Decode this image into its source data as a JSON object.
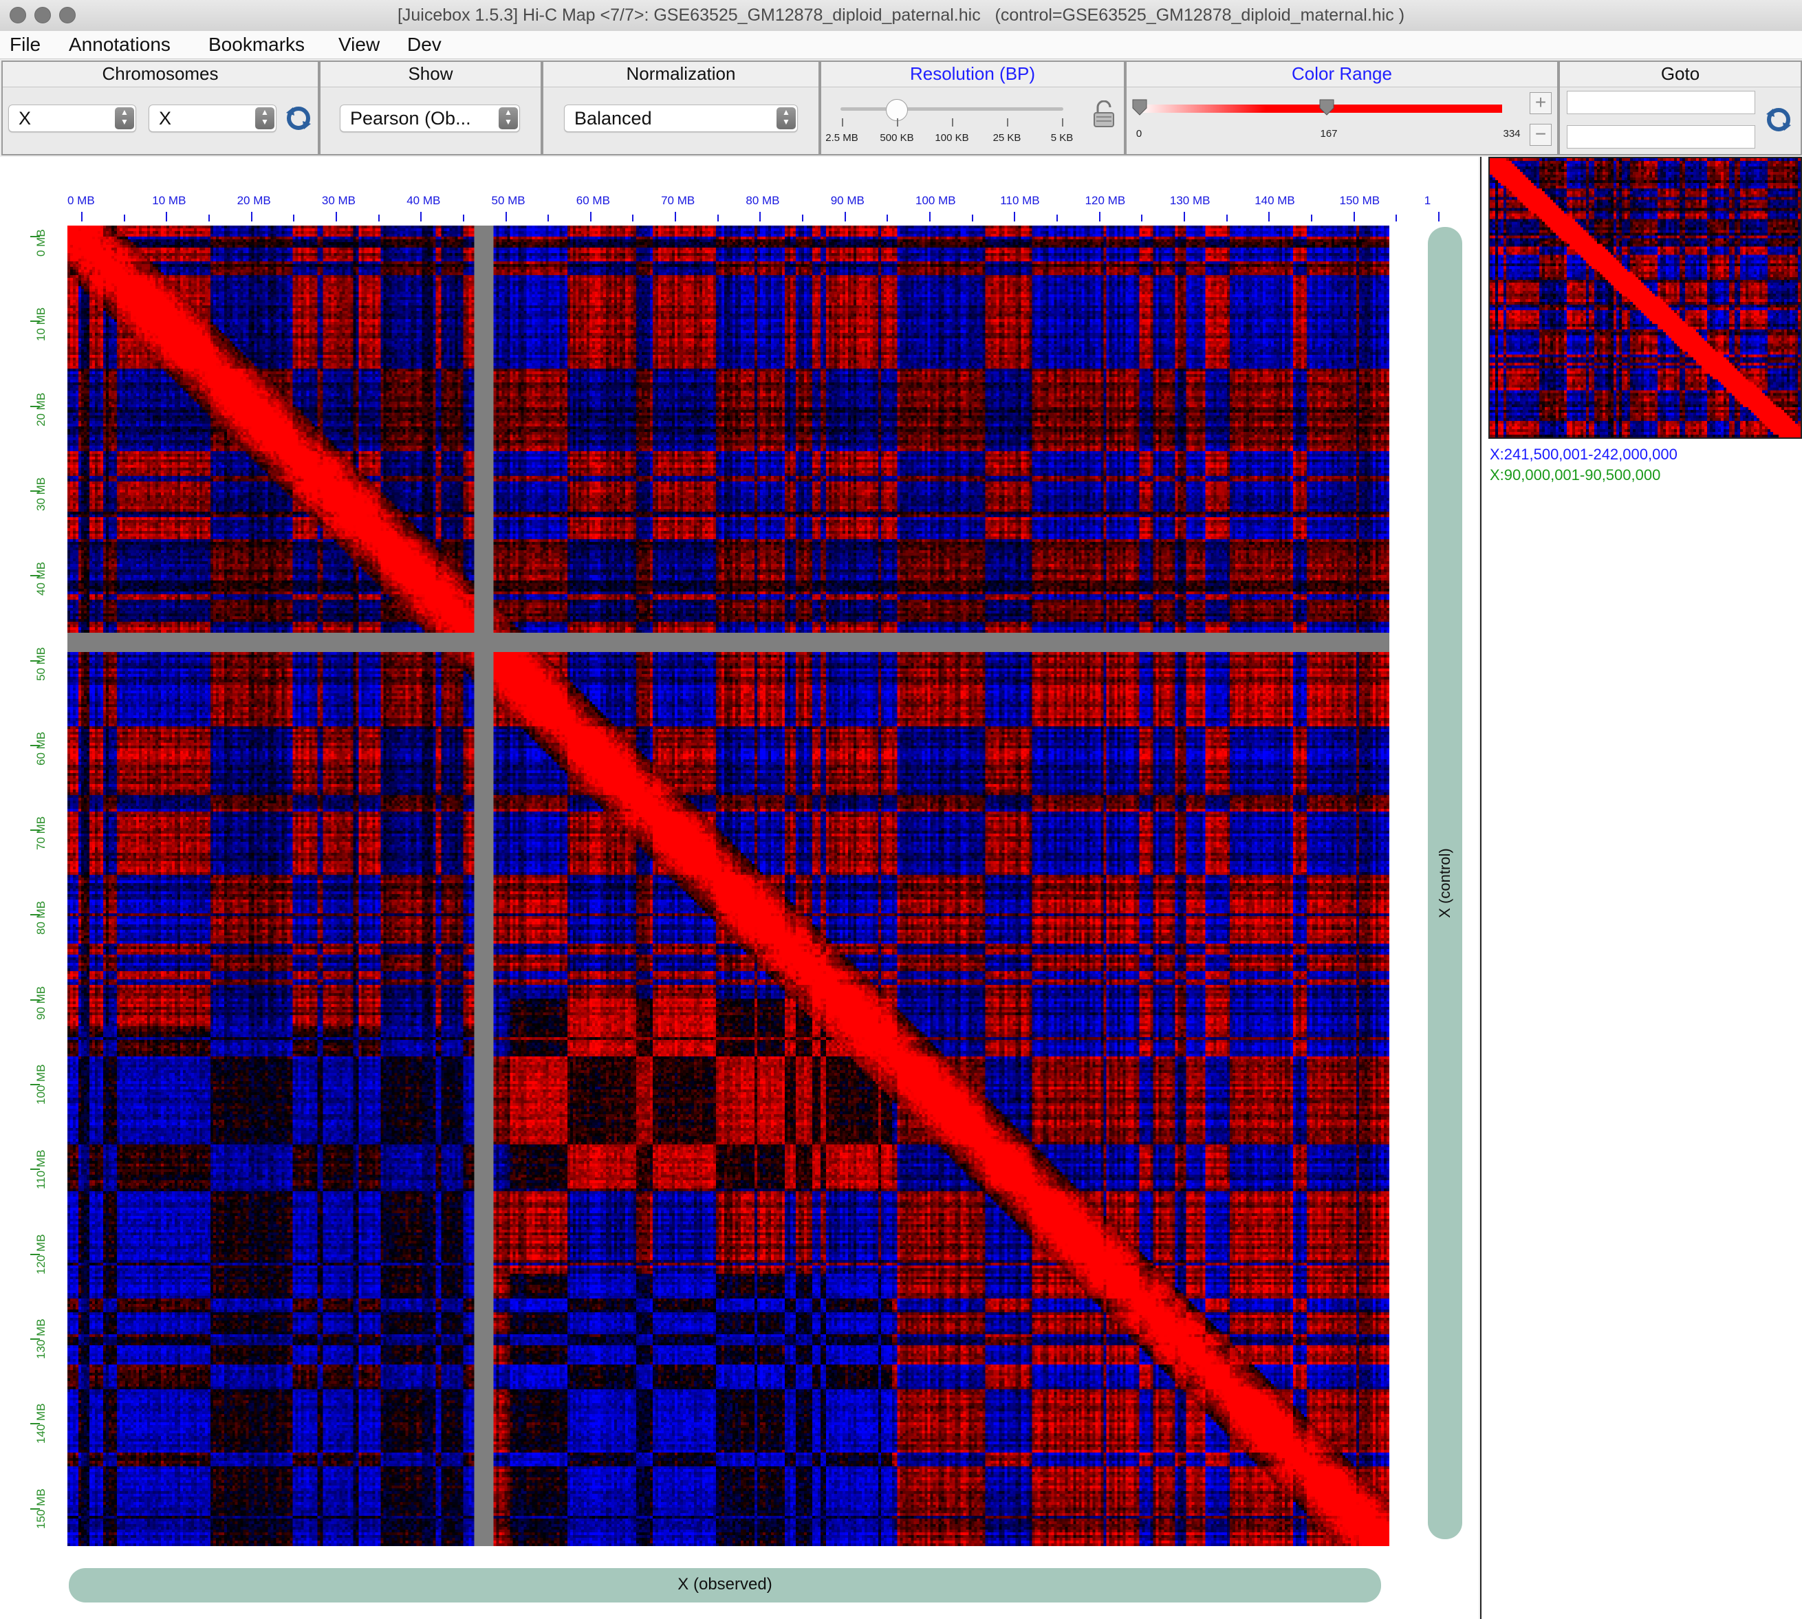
{
  "window": {
    "title": "[Juicebox 1.5.3] Hi-C Map <7/7>: GSE63525_GM12878_diploid_paternal.hic   (control=GSE63525_GM12878_diploid_maternal.hic )"
  },
  "menu": [
    "File",
    "Annotations",
    "Bookmarks",
    "View",
    "Dev"
  ],
  "toolbar": {
    "chromosomes": {
      "label": "Chromosomes",
      "chr1": "X",
      "chr2": "X"
    },
    "show": {
      "label": "Show",
      "value": "Pearson (Ob..."
    },
    "normalization": {
      "label": "Normalization",
      "value": "Balanced"
    },
    "resolution": {
      "label": "Resolution (BP)",
      "ticks": [
        "2.5 MB",
        "500 KB",
        "100 KB",
        "25 KB",
        "5 KB"
      ],
      "selected": "500 KB"
    },
    "color_range": {
      "label": "Color Range",
      "min": "0",
      "mid": "167",
      "max": "334",
      "min_color": "#ffffff",
      "max_color": "#ff0000"
    },
    "goto": {
      "label": "Goto",
      "field1": "",
      "field2": ""
    }
  },
  "map": {
    "x_ticks": [
      "0 MB",
      "10 MB",
      "20 MB",
      "30 MB",
      "40 MB",
      "50 MB",
      "60 MB",
      "70 MB",
      "80 MB",
      "90 MB",
      "100 MB",
      "110 MB",
      "120 MB",
      "130 MB",
      "140 MB",
      "150 MB",
      "1"
    ],
    "y_ticks": [
      "0 MB",
      "10 MB",
      "20 MB",
      "30 MB",
      "40 MB",
      "50 MB",
      "60 MB",
      "70 MB",
      "80 MB",
      "90 MB",
      "100 MB",
      "110 MB",
      "120 MB",
      "130 MB",
      "140 MB",
      "150 MB"
    ],
    "x_axis_label": "X (observed)",
    "y_axis_label": "X (control)",
    "colors": {
      "high": "#ff0000",
      "low": "#0000ff",
      "neutral": "#000000",
      "gap": "#7f7f7f"
    }
  },
  "side_panel": {
    "coord_x": "X:241,500,001-242,000,000",
    "coord_y": "X:90,000,001-90,500,000",
    "coord_x_color": "#1a1aff",
    "coord_y_color": "#1a9a1a"
  }
}
